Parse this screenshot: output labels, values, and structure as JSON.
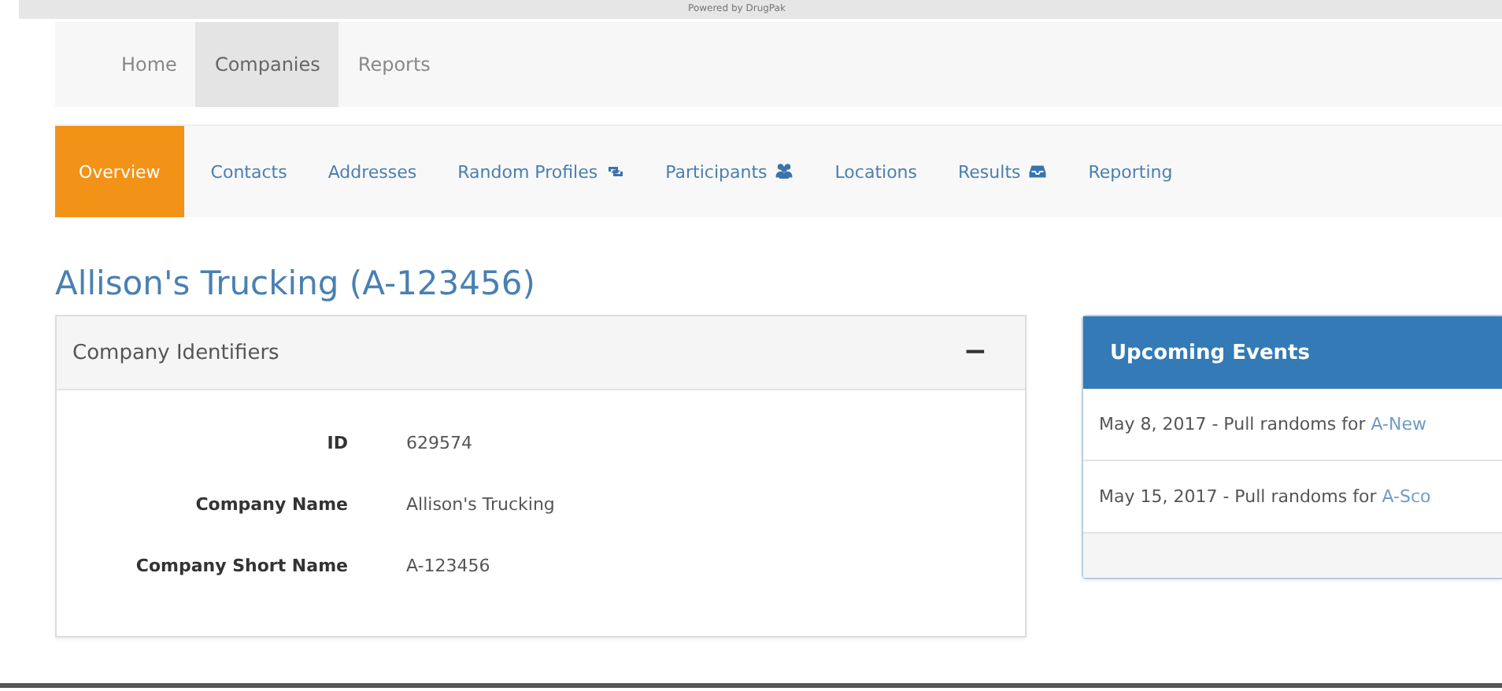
{
  "powered_by": "Powered by DrugPak",
  "main_nav": [
    {
      "label": "Home",
      "selected": false
    },
    {
      "label": "Companies",
      "selected": true
    },
    {
      "label": "Reports",
      "selected": false
    }
  ],
  "sub_nav": [
    {
      "label": "Overview",
      "selected": true
    },
    {
      "label": "Contacts",
      "selected": false
    },
    {
      "label": "Addresses",
      "selected": false
    },
    {
      "label": "Random Profiles",
      "selected": false
    },
    {
      "label": "Participants",
      "selected": false
    },
    {
      "label": "Locations",
      "selected": false
    },
    {
      "label": "Results",
      "selected": false
    },
    {
      "label": "Reporting",
      "selected": false
    }
  ],
  "page_title": "Allison's Trucking (A-123456)",
  "identifiers_panel": {
    "title": "Company Identifiers",
    "collapse_button": "−",
    "fields": [
      {
        "label": "ID",
        "value": "629574"
      },
      {
        "label": "Company Name",
        "value": "Allison's Trucking"
      },
      {
        "label": "Company Short Name",
        "value": "A-123456"
      }
    ]
  },
  "events_panel": {
    "title": "Upcoming Events",
    "events": [
      {
        "text": "May 8, 2017 - Pull randoms for ",
        "link": "A-New"
      },
      {
        "text": "May 15, 2017 - Pull randoms for ",
        "link": "A-Sco"
      }
    ]
  }
}
